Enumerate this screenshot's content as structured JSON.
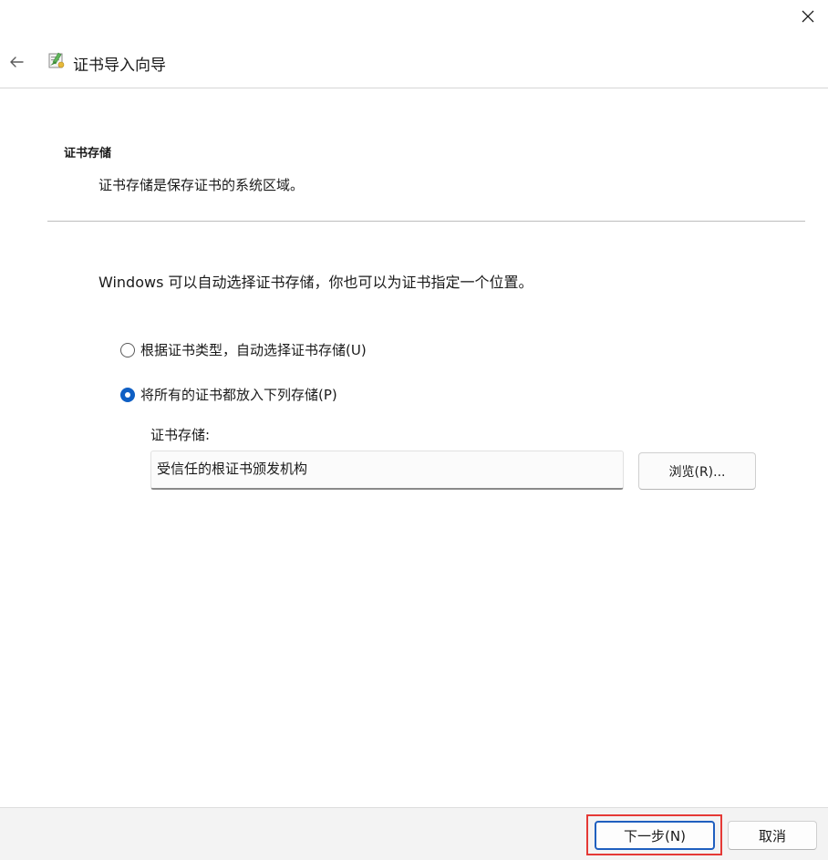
{
  "window": {
    "close_icon": "close-icon"
  },
  "header": {
    "back_icon": "arrow-left-icon",
    "wizard_icon": "certificate-icon",
    "title": "证书导入向导"
  },
  "section": {
    "title": "证书存储",
    "description": "证书存储是保存证书的系统区域。"
  },
  "intro": "Windows 可以自动选择证书存储，你也可以为证书指定一个位置。",
  "options": {
    "auto": {
      "label": "根据证书类型，自动选择证书存储(U)",
      "selected": false
    },
    "manual": {
      "label": "将所有的证书都放入下列存储(P)",
      "selected": true
    }
  },
  "store": {
    "label": "证书存储:",
    "value": "受信任的根证书颁发机构",
    "browse_label": "浏览(R)..."
  },
  "footer": {
    "next_label": "下一步(N)",
    "cancel_label": "取消"
  },
  "colors": {
    "accent": "#0f5fc4",
    "highlight": "#e53935"
  }
}
